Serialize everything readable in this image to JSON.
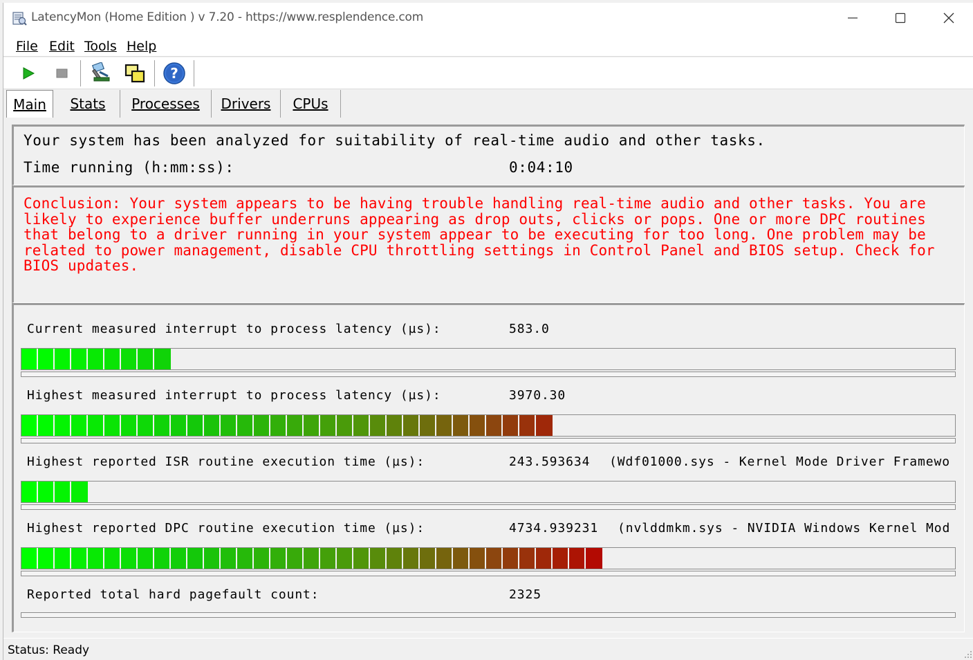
{
  "window": {
    "title": "LatencyMon  (Home Edition )  v 7.20 - https://www.resplendence.com"
  },
  "menu": [
    {
      "label": "File"
    },
    {
      "label": "Edit"
    },
    {
      "label": "Tools"
    },
    {
      "label": "Help"
    }
  ],
  "toolbar": {
    "icons": [
      "play-icon",
      "stop-icon",
      "submit-icon",
      "copy-icon",
      "help-icon"
    ]
  },
  "tabs": [
    {
      "label": "Main",
      "active": true
    },
    {
      "label": "Stats",
      "active": false
    },
    {
      "label": "Processes",
      "active": false
    },
    {
      "label": "Drivers",
      "active": false
    },
    {
      "label": "CPUs",
      "active": false
    }
  ],
  "summary": {
    "headline": "Your system has been analyzed for suitability of real-time audio and other tasks.",
    "time_label": "Time running (h:mm:ss):",
    "time_value": "0:04:10"
  },
  "conclusion": {
    "text": "Conclusion: Your system appears to be having trouble handling real-time audio and other tasks. You are likely to experience buffer underruns appearing as drop outs, clicks or pops. One or more DPC routines that belong to a driver running in your system appear to be executing for too long. One problem may be related to power management, disable CPU throttling settings in Control Panel and BIOS setup. Check for BIOS updates.",
    "color": "#ff0000"
  },
  "metrics": [
    {
      "label": "Current measured interrupt to process latency (µs):",
      "value": "583.0",
      "extra": "",
      "segments_filled": 9
    },
    {
      "label": "Highest measured interrupt to process latency (µs):",
      "value": "3970.30",
      "extra": "",
      "segments_filled": 32
    },
    {
      "label": "Highest reported ISR routine execution time (µs):",
      "value": "243.593634",
      "extra": "(Wdf01000.sys - Kernel Mode Driver Framewo",
      "segments_filled": 4
    },
    {
      "label": "Highest reported DPC routine execution time (µs):",
      "value": "4734.939231",
      "extra": "(nvlddmkm.sys - NVIDIA Windows Kernel Mod",
      "segments_filled": 35
    },
    {
      "label": "Reported total hard pagefault count:",
      "value": "2325",
      "extra": ""
    }
  ],
  "status": {
    "text": "Status: Ready"
  }
}
